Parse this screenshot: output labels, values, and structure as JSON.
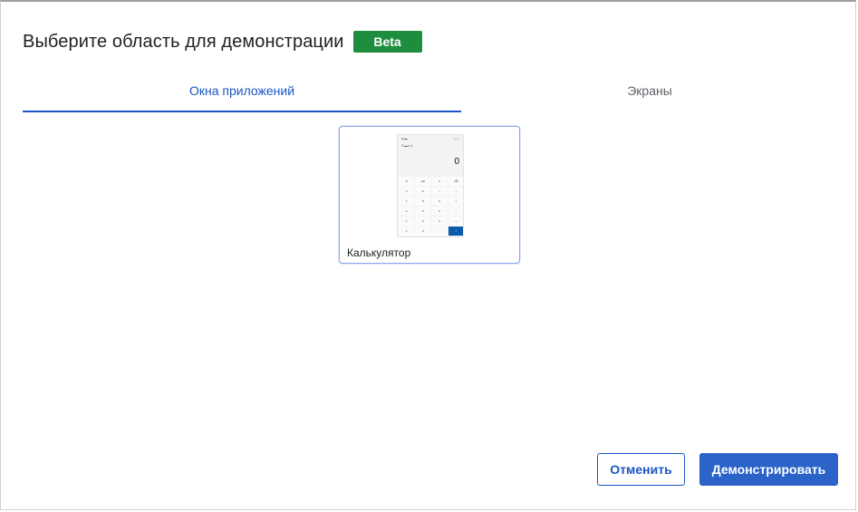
{
  "dialog": {
    "title": "Выберите область для демонстрации",
    "badge": "Beta",
    "colors": {
      "accent": "#1a56c4",
      "badge_bg": "#1e8e3e",
      "primary_button": "#2b63c9"
    }
  },
  "tabs": [
    {
      "label": "Окна приложений",
      "active": true
    },
    {
      "label": "Экраны",
      "active": false
    }
  ],
  "windows": [
    {
      "label": "Калькулятор",
      "icon": "calculator-thumbnail"
    }
  ],
  "buttons": {
    "cancel": "Отменить",
    "share": "Демонстрировать"
  }
}
